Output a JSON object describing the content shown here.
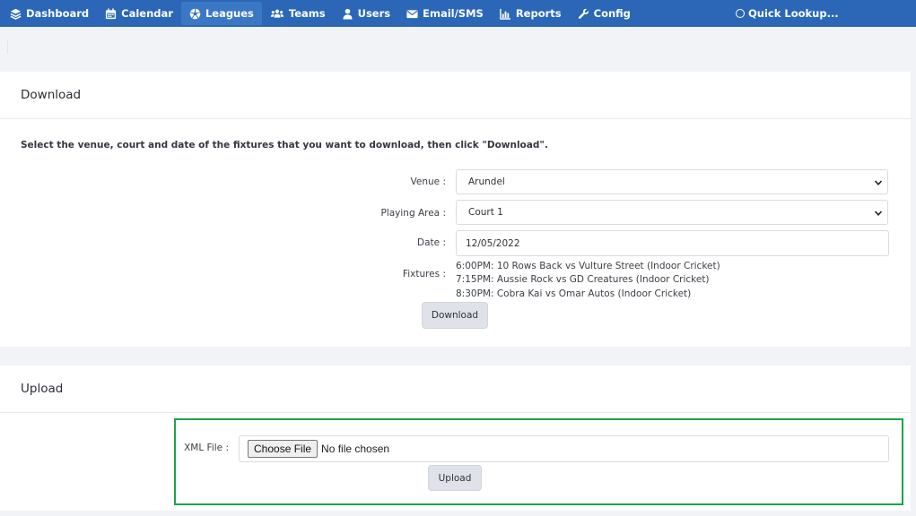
{
  "nav": {
    "items": [
      {
        "label": "Dashboard",
        "icon": "layers-icon"
      },
      {
        "label": "Calendar",
        "icon": "calendar-icon"
      },
      {
        "label": "Leagues",
        "icon": "soccer-ball-icon"
      },
      {
        "label": "Teams",
        "icon": "users-group-icon"
      },
      {
        "label": "Users",
        "icon": "user-icon"
      },
      {
        "label": "Email/SMS",
        "icon": "envelope-icon"
      },
      {
        "label": "Reports",
        "icon": "bar-chart-icon"
      },
      {
        "label": "Config",
        "icon": "wrench-icon"
      }
    ],
    "active": "Leagues",
    "quick_lookup": "Quick Lookup..."
  },
  "download": {
    "title": "Download",
    "instructions": "Select the venue, court and date of the fixtures that you want to download, then click \"Download\".",
    "venue_label": "Venue :",
    "venue_value": "Arundel",
    "area_label": "Playing Area :",
    "area_value": "Court 1",
    "date_label": "Date :",
    "date_value": "12/05/2022",
    "fixtures_label": "Fixtures :",
    "fixtures": [
      "6:00PM: 10 Rows Back vs Vulture Street (Indoor Cricket)",
      "7:15PM: Aussie Rock vs GD Creatures (Indoor Cricket)",
      "8:30PM: Cobra Kai vs Omar Autos (Indoor Cricket)"
    ],
    "button": "Download"
  },
  "upload": {
    "title": "Upload",
    "file_label": "XML File :",
    "choose_button": "Choose File",
    "no_file": "No file chosen",
    "button": "Upload"
  },
  "colors": {
    "navbar": "#2b67b6",
    "highlight": "#1fa24a"
  }
}
